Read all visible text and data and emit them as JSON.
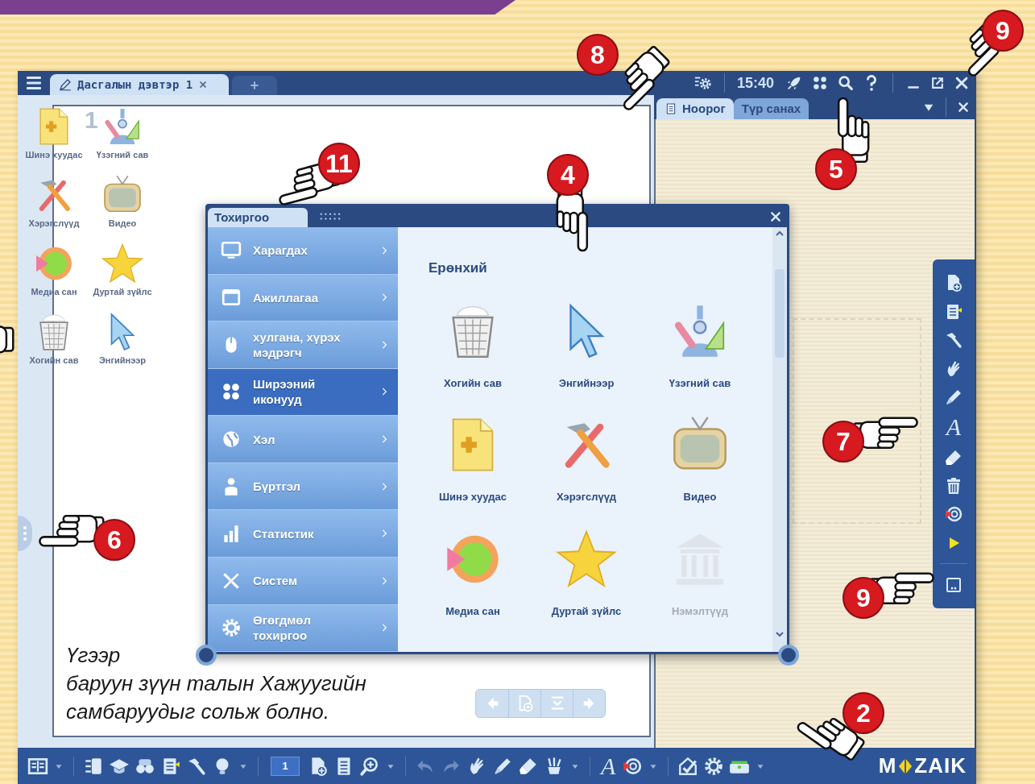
{
  "title_bar": {
    "tab": {
      "label": "Дасгалын дэвтэр 1",
      "selected": true
    },
    "settings_buttons": [
      {
        "kind": "gear_stack"
      }
    ],
    "time": "15:40",
    "tools": [
      {
        "kind": "rocket"
      },
      {
        "kind": "dots"
      },
      {
        "kind": "search"
      },
      {
        "kind": "help"
      }
    ],
    "window_buttons": [
      {
        "kind": "minimize"
      },
      {
        "kind": "popout"
      },
      {
        "kind": "close"
      }
    ]
  },
  "workspace": {
    "page_number": "1",
    "desktop_icons": [
      {
        "label": "Шинэ хуудас",
        "kind": "new_page"
      },
      {
        "label": "Үзэгний сав",
        "kind": "pen_holder"
      },
      {
        "label": "Хэрэгслүүд",
        "kind": "tools"
      },
      {
        "label": "Видео",
        "kind": "tv"
      },
      {
        "label": "Медиа сан",
        "kind": "media"
      },
      {
        "label": "Дуртай зүйлс",
        "kind": "star"
      },
      {
        "label": "Хогийн сав",
        "kind": "trash"
      },
      {
        "label": "Энгийнээр",
        "kind": "pointer"
      }
    ],
    "caption": [
      "Үгээр",
      "баруун зүүн талын Хажуугийн",
      "самбаруудыг сольж болно."
    ],
    "page_nav": [
      {
        "kind": "arrow_left"
      },
      {
        "kind": "page_add_light"
      },
      {
        "kind": "page_down"
      },
      {
        "kind": "arrow_right"
      }
    ]
  },
  "side_panel": {
    "tabs": [
      {
        "label": "Ноорог",
        "selected": true
      },
      {
        "label": "Түр санах",
        "selected": false
      }
    ],
    "toolbar": [
      {
        "kind": "page_add"
      },
      {
        "kind": "doc_arrow"
      },
      {
        "kind": "hammer"
      },
      {
        "kind": "hand"
      },
      {
        "kind": "marker"
      },
      {
        "kind": "text",
        "label": "A"
      },
      {
        "kind": "eraser"
      },
      {
        "kind": "trash_small"
      },
      {
        "kind": "record"
      },
      {
        "kind": "play"
      },
      {
        "kind": "separator"
      },
      {
        "kind": "window_dots"
      }
    ]
  },
  "settings_dialog": {
    "tab": "Тохиргоо",
    "menu": [
      {
        "label": "Харагдах",
        "kind": "monitor",
        "selected": false
      },
      {
        "label": "Ажиллагаа",
        "kind": "window",
        "selected": false
      },
      {
        "label": "хулгана, хүрэх мэдрэгч",
        "kind": "mouse",
        "selected": false
      },
      {
        "label": "Ширээний иконууд",
        "kind": "dots_white",
        "selected": true
      },
      {
        "label": "Хэл",
        "kind": "globe",
        "selected": false
      },
      {
        "label": "Бүртгэл",
        "kind": "person",
        "selected": false
      },
      {
        "label": "Статистик",
        "kind": "bars",
        "selected": false
      },
      {
        "label": "Систем",
        "kind": "tools_sys",
        "selected": false
      },
      {
        "label": "Өгөгдмөл тохиргоо",
        "kind": "gear_white",
        "selected": false
      }
    ],
    "section_title": "Ерөнхий",
    "items": [
      {
        "label": "Хогийн сав",
        "kind": "trash",
        "disabled": false
      },
      {
        "label": "Энгийнээр",
        "kind": "pointer",
        "disabled": false
      },
      {
        "label": "Үзэгний сав",
        "kind": "pen_holder",
        "disabled": false
      },
      {
        "label": "Шинэ хуудас",
        "kind": "new_page",
        "disabled": false
      },
      {
        "label": "Хэрэгслүүд",
        "kind": "tools",
        "disabled": false
      },
      {
        "label": "Видео",
        "kind": "tv",
        "disabled": false
      },
      {
        "label": "Медиа сан",
        "kind": "media",
        "disabled": false
      },
      {
        "label": "Дуртай зүйлс",
        "kind": "star",
        "disabled": false
      },
      {
        "label": "Нэмэлтүүд",
        "kind": "museum",
        "disabled": true
      }
    ]
  },
  "bottom_toolbar": {
    "items": [
      {
        "kind": "book"
      },
      {
        "kind": "caret"
      },
      {
        "kind": "separator"
      },
      {
        "kind": "binder"
      },
      {
        "kind": "grad_cap"
      },
      {
        "kind": "binoculars"
      },
      {
        "kind": "doc_arrow"
      },
      {
        "kind": "hammer"
      },
      {
        "kind": "bulb"
      },
      {
        "kind": "caret"
      },
      {
        "kind": "separator"
      },
      {
        "kind": "page_field",
        "label": "1"
      },
      {
        "kind": "page_add"
      },
      {
        "kind": "page_lines"
      },
      {
        "kind": "zoom_plus"
      },
      {
        "kind": "caret"
      },
      {
        "kind": "separator"
      },
      {
        "kind": "undo"
      },
      {
        "kind": "redo"
      },
      {
        "kind": "hand"
      },
      {
        "kind": "marker"
      },
      {
        "kind": "eraser"
      },
      {
        "kind": "paint_cup"
      },
      {
        "kind": "caret"
      },
      {
        "kind": "separator"
      },
      {
        "kind": "text",
        "label": "A"
      },
      {
        "kind": "record"
      },
      {
        "kind": "caret"
      },
      {
        "kind": "separator"
      },
      {
        "kind": "house_check"
      },
      {
        "kind": "gear"
      },
      {
        "kind": "scanner"
      },
      {
        "kind": "caret"
      }
    ],
    "logo": {
      "before": "M",
      "after": "ZAIK"
    }
  },
  "callouts": [
    {
      "number": "8"
    },
    {
      "number": "9"
    },
    {
      "number": "11"
    },
    {
      "number": "4"
    },
    {
      "number": "5"
    },
    {
      "number": "6"
    },
    {
      "number": "7"
    },
    {
      "number": "9"
    },
    {
      "number": "2"
    }
  ]
}
